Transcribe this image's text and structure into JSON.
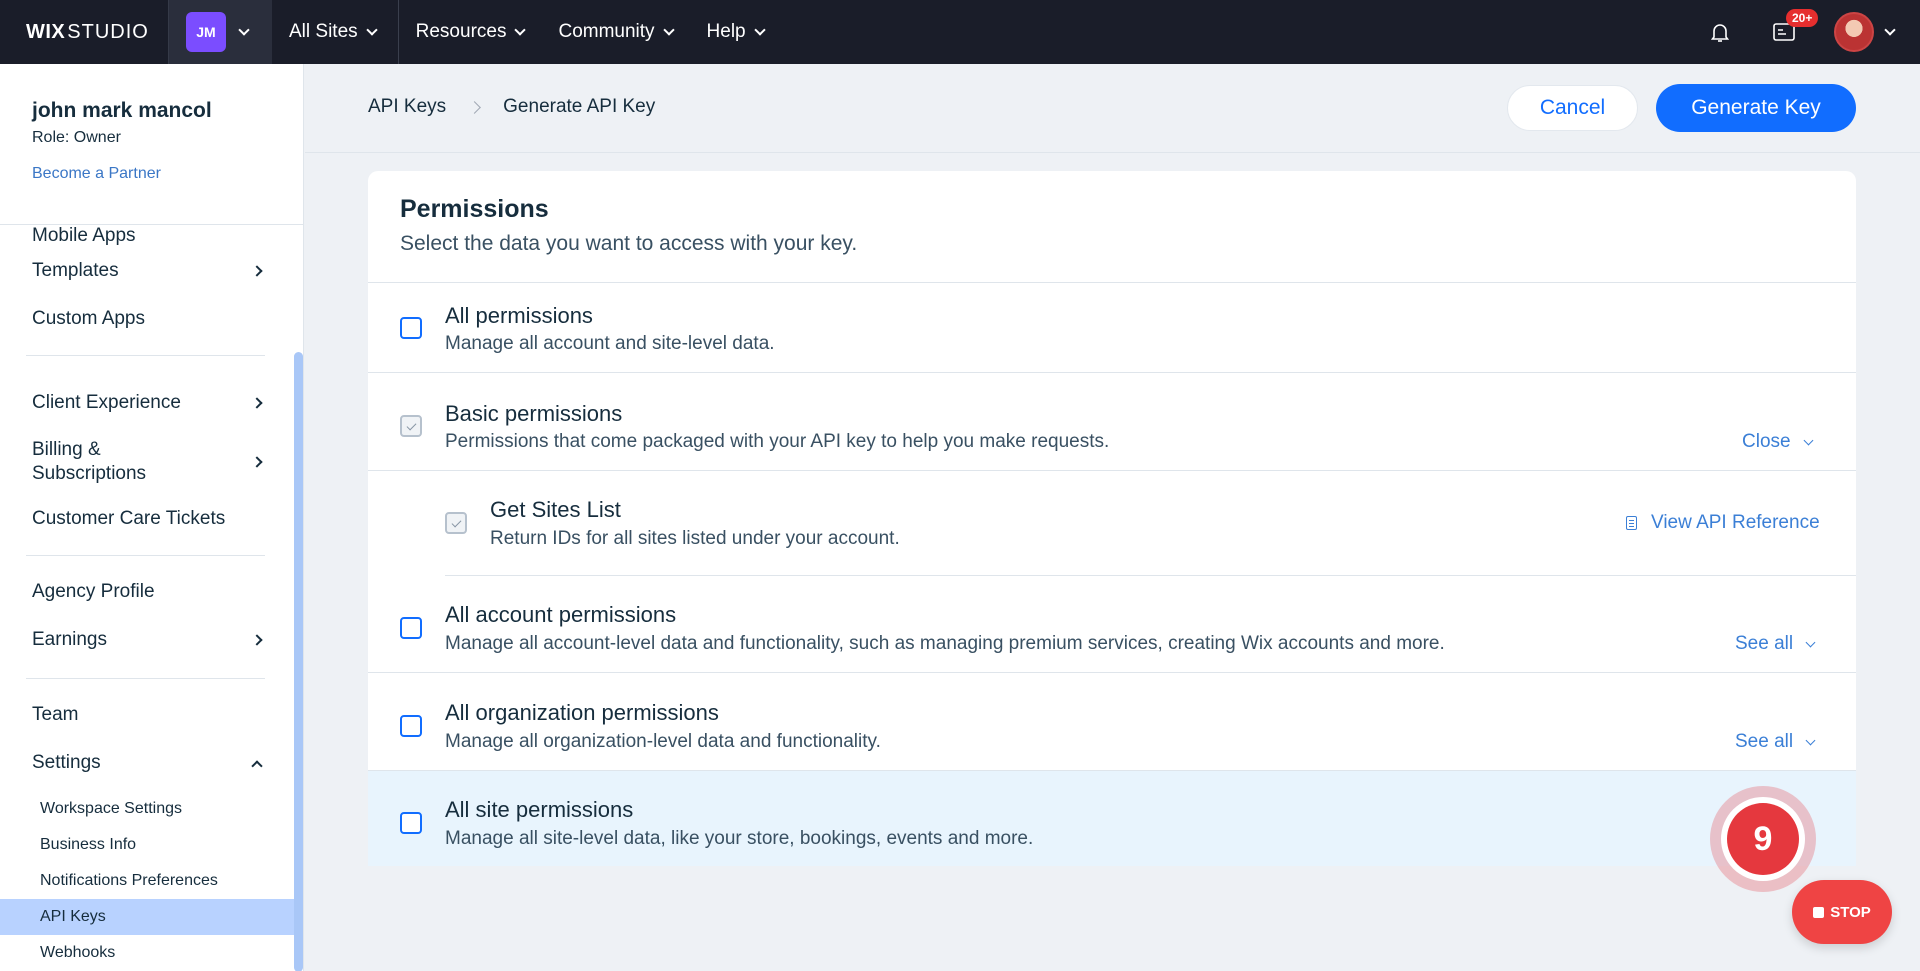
{
  "topbar": {
    "logo_bold": "WIX",
    "logo_thin": "STUDIO",
    "workspace_initials": "JM",
    "sites_label": "All Sites",
    "nav": [
      "Resources",
      "Community",
      "Help"
    ],
    "inbox_badge": "20+"
  },
  "sidebar": {
    "user_name": "john mark mancol",
    "role": "Role: Owner",
    "partner_link": "Become a Partner",
    "items_group1": [
      {
        "label": "Mobile Apps",
        "arrow": false
      },
      {
        "label": "Templates",
        "arrow": true
      },
      {
        "label": "Custom Apps",
        "arrow": false
      }
    ],
    "items_group2": [
      {
        "label": "Client Experience",
        "arrow": true
      },
      {
        "label": "Billing & Subscriptions",
        "arrow": true
      },
      {
        "label": "Customer Care Tickets",
        "arrow": false
      }
    ],
    "items_group3": [
      {
        "label": "Agency Profile",
        "arrow": false
      },
      {
        "label": "Earnings",
        "arrow": true
      }
    ],
    "team": "Team",
    "settings": "Settings",
    "settings_sub": [
      "Workspace Settings",
      "Business Info",
      "Notifications Preferences",
      "API Keys",
      "Webhooks"
    ],
    "active_sub": "API Keys"
  },
  "header": {
    "breadcrumb_root": "API Keys",
    "breadcrumb_current": "Generate API Key",
    "cancel_label": "Cancel",
    "generate_label": "Generate Key"
  },
  "permissions": {
    "title": "Permissions",
    "subtitle": "Select the data you want to access with your key.",
    "rows": [
      {
        "title": "All permissions",
        "desc": "Manage all account and site-level data."
      },
      {
        "title": "Basic permissions",
        "desc": "Permissions that come packaged with your API key to help you make requests.",
        "action": "Close"
      },
      {
        "title": "Get Sites List",
        "desc": "Return IDs for all sites listed under your account.",
        "action": "View API Reference"
      },
      {
        "title": "All account permissions",
        "desc": "Manage all account-level data and functionality, such as managing premium services, creating Wix accounts and more.",
        "action": "See all"
      },
      {
        "title": "All organization permissions",
        "desc": "Manage all organization-level data and functionality.",
        "action": "See all"
      },
      {
        "title": "All site permissions",
        "desc": "Manage all site-level data, like your store, bookings, events and more."
      }
    ]
  },
  "overlay": {
    "counter": "9",
    "stop_label": "STOP"
  },
  "colors": {
    "accent": "#116dff",
    "topbar": "#1a1d29",
    "active_sidebar": "#b8d2ff",
    "stop": "#ef4444"
  }
}
